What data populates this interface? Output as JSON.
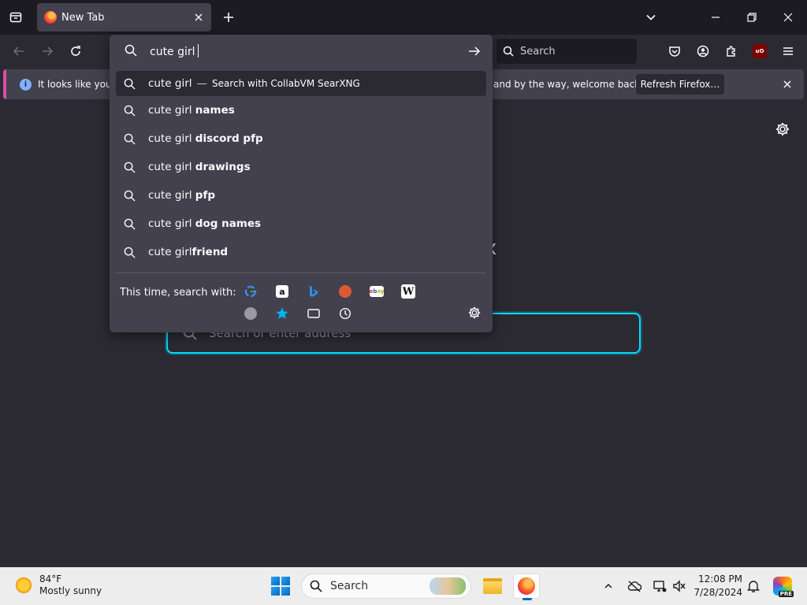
{
  "tab": {
    "title": "New Tab"
  },
  "toolbar": {
    "search_placeholder": "Search"
  },
  "urlbar": {
    "value": "cute girl"
  },
  "suggestions": [
    {
      "prefix": "cute girl",
      "bold": "",
      "engine_text": "Search with CollabVM SearXNG"
    },
    {
      "prefix": "cute girl ",
      "bold": "names"
    },
    {
      "prefix": "cute girl ",
      "bold": "discord pfp"
    },
    {
      "prefix": "cute girl ",
      "bold": "drawings"
    },
    {
      "prefix": "cute girl ",
      "bold": "pfp"
    },
    {
      "prefix": "cute girl ",
      "bold": "dog names"
    },
    {
      "prefix": "cute girl",
      "bold": "friend"
    }
  ],
  "one_time_search": {
    "label": "This time, search with:"
  },
  "notification": {
    "text_left": "It looks like you ha",
    "text_right": "and by the way, welcome back!",
    "button": "Refresh Firefox…"
  },
  "newtab": {
    "search_placeholder": "Search or enter address",
    "logo_fragment": "x"
  },
  "taskbar": {
    "weather_temp": "84°F",
    "weather_desc": "Mostly sunny",
    "search_label": "Search",
    "time": "12:08 PM",
    "date": "7/28/2024",
    "copilot_badge": "PRE"
  },
  "icons": {
    "engines": [
      "google-icon",
      "amazon-icon",
      "bing-icon",
      "duckduckgo-icon",
      "ebay-icon",
      "wikipedia-icon"
    ],
    "modes": [
      "search-engine-icon",
      "bookmarks-icon",
      "tabs-icon",
      "history-icon"
    ]
  },
  "colors": {
    "accent": "#00ddff",
    "notification_stripe": "#d84fa0",
    "info": "#80b2ff"
  }
}
